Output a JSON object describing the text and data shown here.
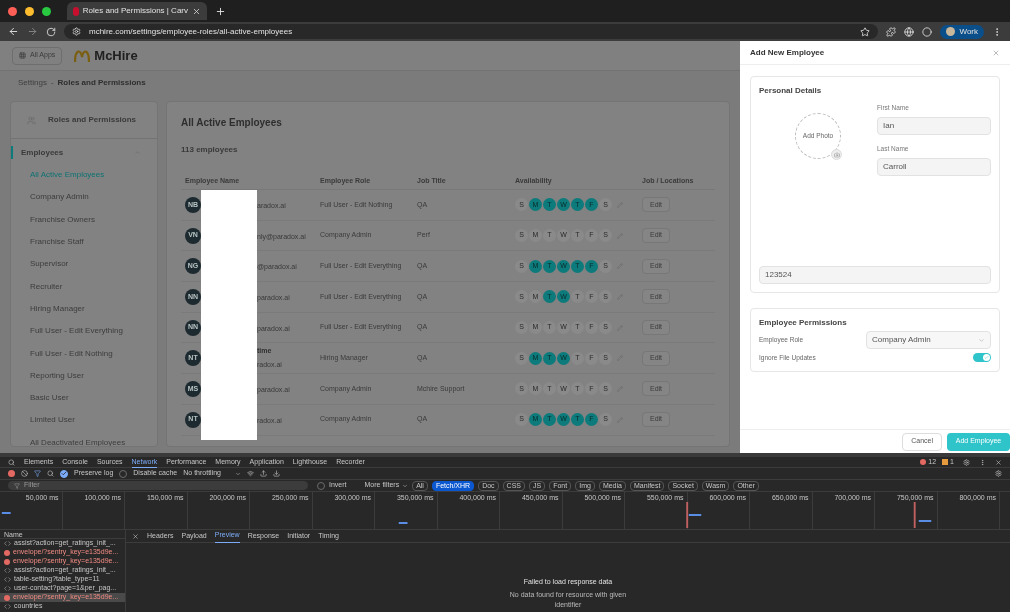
{
  "browser": {
    "tab_title": "Roles and Permissions | Carv",
    "url": "mchire.com/settings/employee-roles/all-active-employees",
    "profile": "Work"
  },
  "app": {
    "all_apps": "All Apps",
    "brand": "McHire",
    "breadcrumb": {
      "parent": "Settings",
      "separator": "-",
      "current": "Roles and Permissions"
    }
  },
  "sidebar": {
    "title": "Roles and Permissions",
    "section": "Employees",
    "items": [
      {
        "label": "All Active Employees",
        "selected": true
      },
      {
        "label": "Company Admin",
        "selected": false
      },
      {
        "label": "Franchise Owners",
        "selected": false
      },
      {
        "label": "Franchise Staff",
        "selected": false
      },
      {
        "label": "Supervisor",
        "selected": false
      },
      {
        "label": "Recruiter",
        "selected": false
      },
      {
        "label": "Hiring Manager",
        "selected": false
      },
      {
        "label": "Full User - Edit Everything",
        "selected": false
      },
      {
        "label": "Full User - Edit Nothing",
        "selected": false
      },
      {
        "label": "Reporting User",
        "selected": false
      },
      {
        "label": "Basic User",
        "selected": false
      },
      {
        "label": "Limited User",
        "selected": false
      },
      {
        "label": "All Deactivated Employees",
        "selected": false
      }
    ]
  },
  "table": {
    "title": "All Active Employees",
    "count": "113 employees",
    "columns": [
      "Employee Name",
      "Employee Role",
      "Job Title",
      "Availability",
      "Job / Locations"
    ],
    "rows": [
      {
        "initials": "NB",
        "name": "",
        "email": "aradox.ai",
        "role": "Full User - Edit Nothing",
        "job_title": "QA",
        "days": [
          {
            "d": "S",
            "on": false
          },
          {
            "d": "M",
            "on": true
          },
          {
            "d": "T",
            "on": true
          },
          {
            "d": "W",
            "on": true
          },
          {
            "d": "T",
            "on": true
          },
          {
            "d": "F",
            "on": true
          },
          {
            "d": "S",
            "on": false
          }
        ],
        "action": "Edit"
      },
      {
        "initials": "VN",
        "name": "",
        "email": "nly@paradox.ai",
        "role": "Company Admin",
        "job_title": "Perf",
        "days": [
          {
            "d": "S",
            "on": false
          },
          {
            "d": "M",
            "on": false
          },
          {
            "d": "T",
            "on": false
          },
          {
            "d": "W",
            "on": false
          },
          {
            "d": "T",
            "on": false
          },
          {
            "d": "F",
            "on": false
          },
          {
            "d": "S",
            "on": false
          }
        ],
        "action": "Edit"
      },
      {
        "initials": "NG",
        "name": "",
        "email": "@paradox.ai",
        "role": "Full User - Edit Everything",
        "job_title": "QA",
        "days": [
          {
            "d": "S",
            "on": false
          },
          {
            "d": "M",
            "on": true
          },
          {
            "d": "T",
            "on": true
          },
          {
            "d": "W",
            "on": true
          },
          {
            "d": "T",
            "on": true
          },
          {
            "d": "F",
            "on": true
          },
          {
            "d": "S",
            "on": false
          }
        ],
        "action": "Edit"
      },
      {
        "initials": "NN",
        "name": "",
        "email": "paradox.ai",
        "role": "Full User - Edit Everything",
        "job_title": "QA",
        "days": [
          {
            "d": "S",
            "on": false
          },
          {
            "d": "M",
            "on": false
          },
          {
            "d": "T",
            "on": true
          },
          {
            "d": "W",
            "on": true
          },
          {
            "d": "T",
            "on": false
          },
          {
            "d": "F",
            "on": false
          },
          {
            "d": "S",
            "on": false
          }
        ],
        "action": "Edit"
      },
      {
        "initials": "NN",
        "name": "",
        "email": "paradox.ai",
        "role": "Full User - Edit Everything",
        "job_title": "QA",
        "days": [
          {
            "d": "S",
            "on": false
          },
          {
            "d": "M",
            "on": false
          },
          {
            "d": "T",
            "on": false
          },
          {
            "d": "W",
            "on": false
          },
          {
            "d": "T",
            "on": false
          },
          {
            "d": "F",
            "on": false
          },
          {
            "d": "S",
            "on": false
          }
        ],
        "action": "Edit"
      },
      {
        "initials": "NT",
        "name": "time",
        "email": "radox.ai",
        "role": "Hiring Manager",
        "job_title": "QA",
        "days": [
          {
            "d": "S",
            "on": false
          },
          {
            "d": "M",
            "on": true
          },
          {
            "d": "T",
            "on": true
          },
          {
            "d": "W",
            "on": true
          },
          {
            "d": "T",
            "on": false
          },
          {
            "d": "F",
            "on": false
          },
          {
            "d": "S",
            "on": false
          }
        ],
        "action": "Edit"
      },
      {
        "initials": "MS",
        "name": "",
        "email": "paradox.ai",
        "role": "Company Admin",
        "job_title": "Mchire Support",
        "days": [
          {
            "d": "S",
            "on": false
          },
          {
            "d": "M",
            "on": false
          },
          {
            "d": "T",
            "on": false
          },
          {
            "d": "W",
            "on": false
          },
          {
            "d": "T",
            "on": false
          },
          {
            "d": "F",
            "on": false
          },
          {
            "d": "S",
            "on": false
          }
        ],
        "action": "Edit"
      },
      {
        "initials": "NT",
        "name": "",
        "email": "radox.ai",
        "role": "Company Admin",
        "job_title": "QA",
        "days": [
          {
            "d": "S",
            "on": false
          },
          {
            "d": "M",
            "on": true
          },
          {
            "d": "T",
            "on": true
          },
          {
            "d": "W",
            "on": true
          },
          {
            "d": "T",
            "on": true
          },
          {
            "d": "F",
            "on": true
          },
          {
            "d": "S",
            "on": false
          }
        ],
        "action": "Edit"
      }
    ]
  },
  "drawer": {
    "title": "Add New Employee",
    "personal": {
      "title": "Personal Details",
      "add_photo": "Add Photo",
      "first_name_label": "First Name",
      "first_name": "Ian",
      "last_name_label": "Last Name",
      "last_name": "Carroll",
      "id_value": "123524"
    },
    "permissions": {
      "title": "Employee Permissions",
      "role_label": "Employee Role",
      "role": "Company Admin",
      "ignore_label": "Ignore File Updates",
      "ignore_on": true
    },
    "cancel": "Cancel",
    "submit": "Add Employee"
  },
  "devtools": {
    "tabs": [
      {
        "label": "Elements",
        "selected": false
      },
      {
        "label": "Console",
        "selected": false
      },
      {
        "label": "Sources",
        "selected": false
      },
      {
        "label": "Network",
        "selected": true
      },
      {
        "label": "Performance",
        "selected": false
      },
      {
        "label": "Memory",
        "selected": false
      },
      {
        "label": "Application",
        "selected": false
      },
      {
        "label": "Lighthouse",
        "selected": false
      },
      {
        "label": "Recorder",
        "selected": false
      }
    ],
    "errors": "12",
    "warnings": "1",
    "preserve_log": {
      "label": "Preserve log",
      "checked": true
    },
    "disable_cache": {
      "label": "Disable cache",
      "checked": false
    },
    "throttling": "No throttling",
    "filter_placeholder": "Filter",
    "invert": {
      "label": "Invert",
      "checked": false
    },
    "more_filters": "More filters",
    "types": [
      {
        "label": "All",
        "selected": false
      },
      {
        "label": "Fetch/XHR",
        "selected": true
      },
      {
        "label": "Doc",
        "selected": false
      },
      {
        "label": "CSS",
        "selected": false
      },
      {
        "label": "JS",
        "selected": false
      },
      {
        "label": "Font",
        "selected": false
      },
      {
        "label": "Img",
        "selected": false
      },
      {
        "label": "Media",
        "selected": false
      },
      {
        "label": "Manifest",
        "selected": false
      },
      {
        "label": "Socket",
        "selected": false
      },
      {
        "label": "Wasm",
        "selected": false
      },
      {
        "label": "Other",
        "selected": false
      }
    ],
    "ticks": [
      "50,000 ms",
      "100,000 ms",
      "150,000 ms",
      "200,000 ms",
      "250,000 ms",
      "300,000 ms",
      "350,000 ms",
      "400,000 ms",
      "450,000 ms",
      "500,000 ms",
      "550,000 ms",
      "600,000 ms",
      "650,000 ms",
      "700,000 ms",
      "750,000 ms",
      "800,000 ms"
    ],
    "name_header": "Name",
    "requests": [
      {
        "name": "assist?action=get_ratings_init_...",
        "kind": "fetch",
        "selected": false
      },
      {
        "name": "envelope/?sentry_key=e135d9e...",
        "kind": "error",
        "selected": false
      },
      {
        "name": "envelope/?sentry_key=e135d9e...",
        "kind": "error",
        "selected": false
      },
      {
        "name": "assist?action=get_ratings_init_...",
        "kind": "fetch",
        "selected": false
      },
      {
        "name": "table-setting?table_type=11",
        "kind": "fetch",
        "selected": false
      },
      {
        "name": "user-contact?page=1&per_pag...",
        "kind": "fetch",
        "selected": false
      },
      {
        "name": "envelope/?sentry_key=e135d9e...",
        "kind": "error",
        "selected": true
      },
      {
        "name": "countries",
        "kind": "fetch",
        "selected": false
      }
    ],
    "detail_tabs": [
      {
        "label": "Headers",
        "selected": false
      },
      {
        "label": "Payload",
        "selected": false
      },
      {
        "label": "Preview",
        "selected": true
      },
      {
        "label": "Response",
        "selected": false
      },
      {
        "label": "Initiator",
        "selected": false
      },
      {
        "label": "Timing",
        "selected": false
      }
    ],
    "message": "Failed to load response data",
    "submessage": "No data found for resource with given identifier"
  }
}
